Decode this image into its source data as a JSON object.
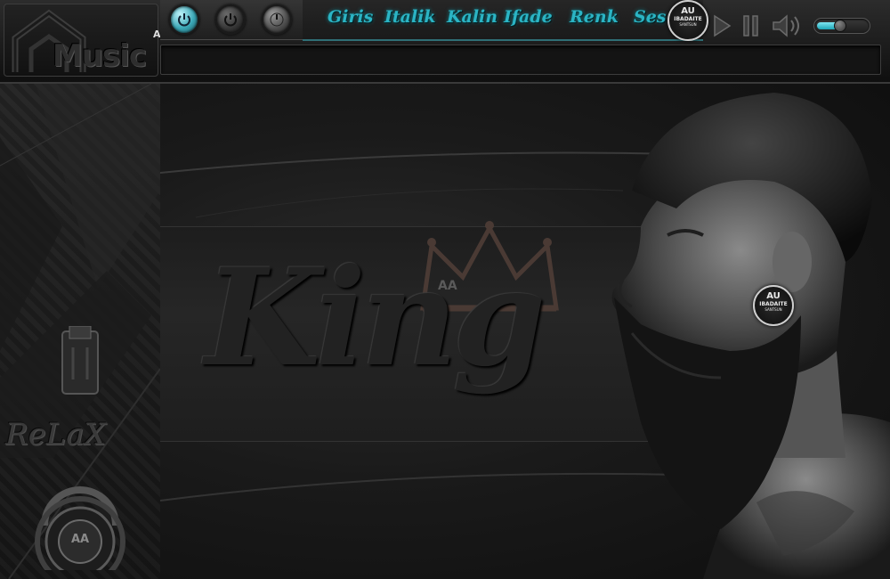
{
  "logo": {
    "text": "Music",
    "tag": "AA"
  },
  "top_controls": {
    "knobs": [
      {
        "name": "power-on",
        "icon": "power-icon",
        "active": true
      },
      {
        "name": "power",
        "icon": "power-icon",
        "active": false
      },
      {
        "name": "dial",
        "icon": "dial-icon",
        "active": false
      }
    ]
  },
  "menu": {
    "items": [
      "Giris",
      "Italik",
      "Kalin",
      "Ifade",
      "Renk",
      "Ses"
    ]
  },
  "badge": {
    "line1": "AU",
    "line2": "IBADAITE",
    "line3": "SANTSUN"
  },
  "player": {
    "play_icon": "play-icon",
    "pause_icon": "pause-icon",
    "volume_icon": "speaker-icon",
    "volume_level": 0.45
  },
  "left_panel": {
    "relax_text": "ReLaX",
    "headphone_tag": "AA"
  },
  "stage": {
    "title": "King",
    "tag": "AA"
  },
  "colors": {
    "accent": "#2bb4c4",
    "background": "#141414"
  }
}
